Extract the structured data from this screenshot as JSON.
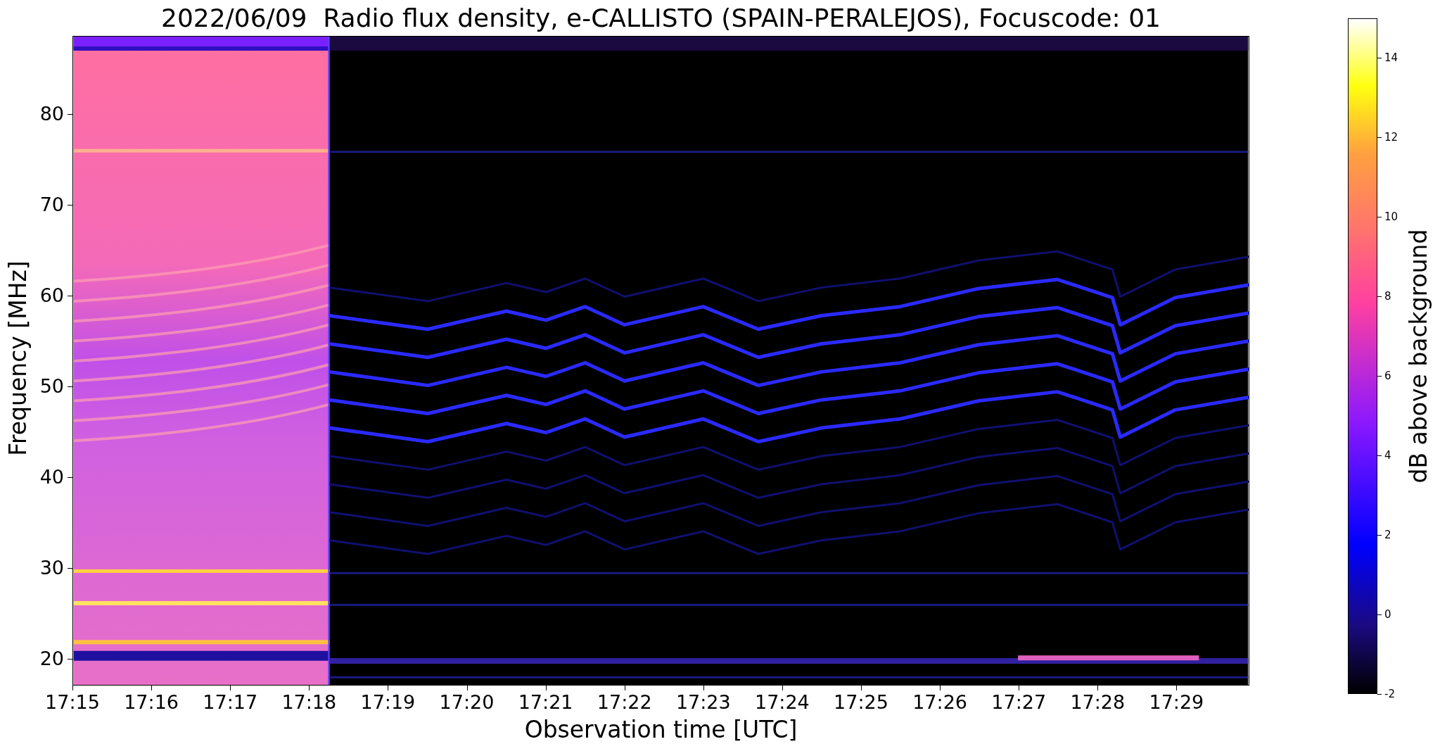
{
  "title": "2022/06/09  Radio flux density, e-CALLISTO (SPAIN-PERALEJOS), Focuscode: 01",
  "y_axis": {
    "label": "Frequency [MHz]",
    "ticks": [
      "80",
      "70",
      "60",
      "50",
      "40",
      "30",
      "20"
    ]
  },
  "x_axis": {
    "label": "Observation time [UTC]",
    "ticks": [
      "17:15",
      "17:16",
      "17:17",
      "17:18",
      "17:19",
      "17:20",
      "17:21",
      "17:22",
      "17:23",
      "17:24",
      "17:25",
      "17:26",
      "17:27",
      "17:28",
      "17:29"
    ]
  },
  "colorbar": {
    "label": "dB above background",
    "ticks": [
      "14",
      "12",
      "10",
      "8",
      "6",
      "4",
      "2",
      "0",
      "-2"
    ]
  }
}
